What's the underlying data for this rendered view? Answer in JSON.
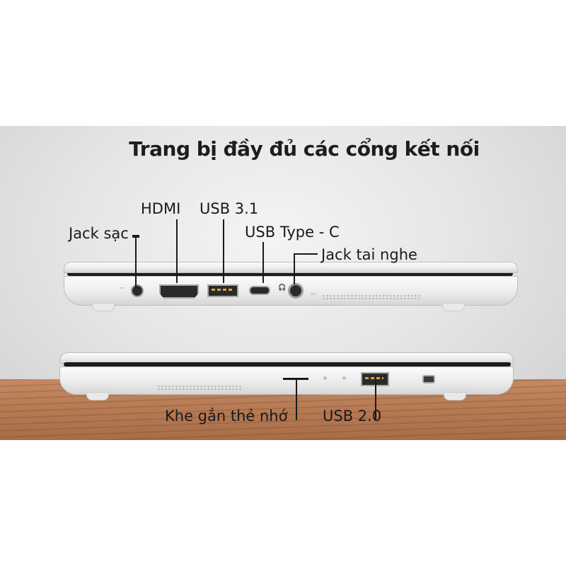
{
  "title": "Trang bị đầy đủ các cổng kết nối",
  "labels": {
    "jack_sac": "Jack sạc",
    "hdmi": "HDMI",
    "usb31": "USB 3.1",
    "usb_type_c": "USB Type - C",
    "jack_tai_nghe": "Jack tai nghe",
    "khe_the_nho": "Khe gắn thẻ nhớ",
    "usb20": "USB 2.0"
  },
  "colors": {
    "background_wall": "#e6e6e6",
    "table_wood": "#b97d56",
    "text": "#1a1a1a",
    "laptop_shell": "#ececec"
  },
  "icons": [
    "dc-power-icon",
    "hdmi-icon",
    "usb-icon",
    "usb-c-icon",
    "headphone-icon",
    "sd-card-icon",
    "led-indicator-icon",
    "kensington-lock-icon"
  ]
}
